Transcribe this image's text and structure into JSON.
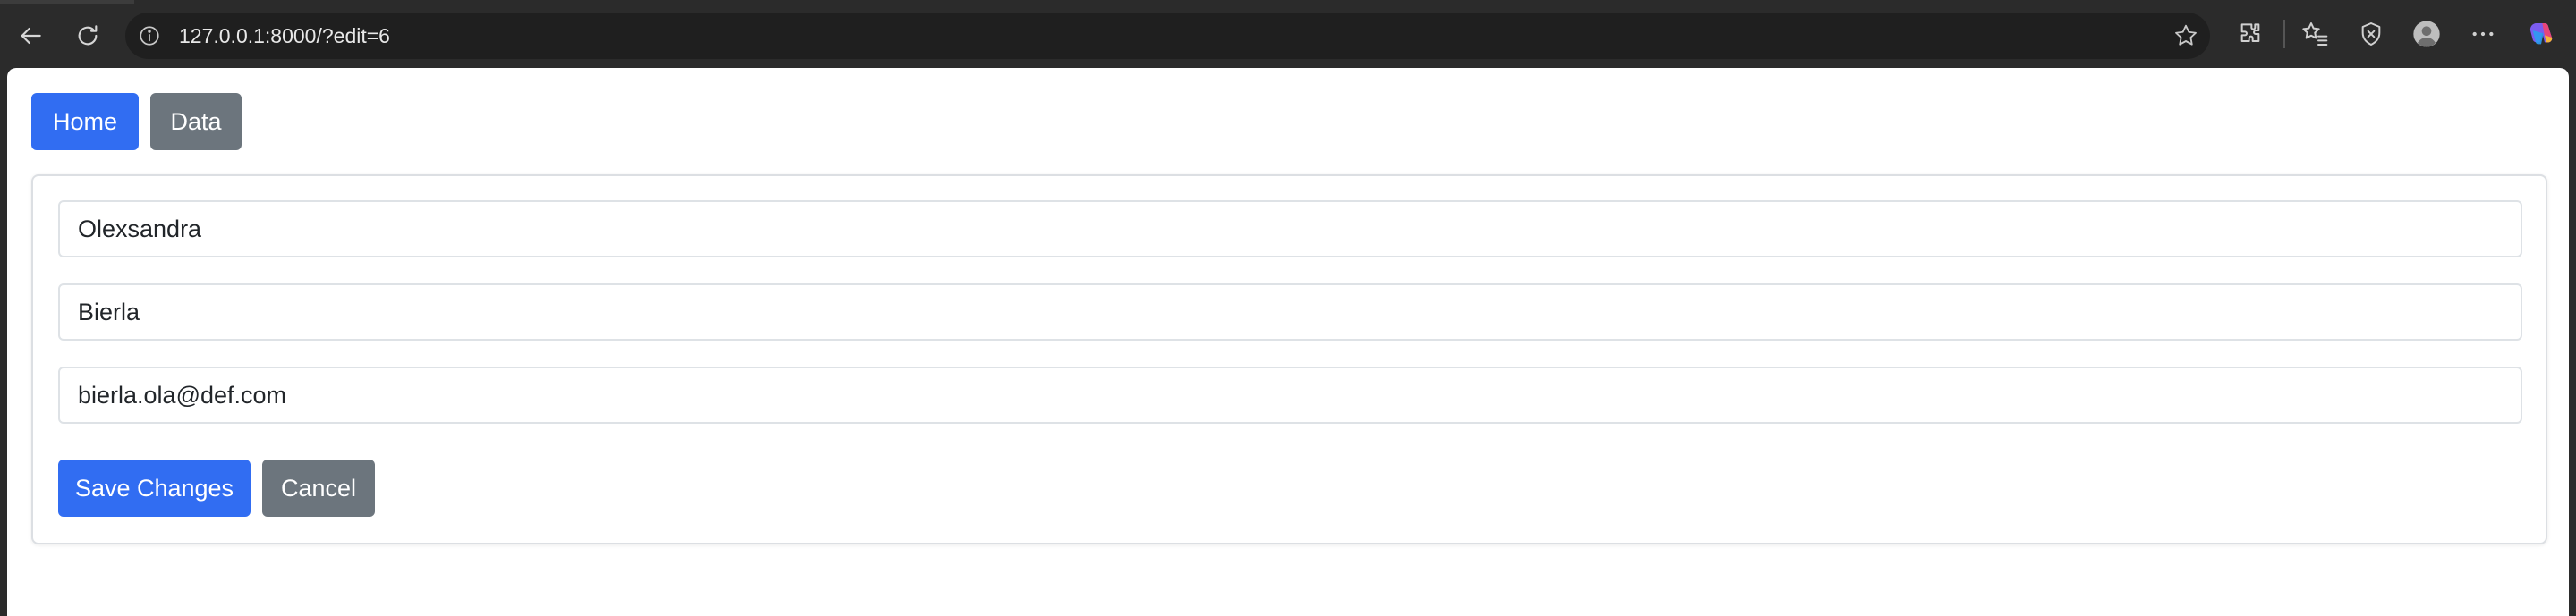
{
  "browser": {
    "url": "127.0.0.1:8000/?edit=6",
    "icons": [
      "back-arrow-icon",
      "reload-icon",
      "site-info-icon",
      "favorite-star-icon",
      "extensions-icon",
      "favorites-icon",
      "browser-essentials-icon",
      "profile-icon",
      "more-icon",
      "copilot-icon"
    ]
  },
  "nav": {
    "home_label": "Home",
    "data_label": "Data"
  },
  "form": {
    "first_name": "Olexsandra",
    "last_name": "Bierla",
    "email": "bierla.ola@def.com",
    "save_label": "Save Changes",
    "cancel_label": "Cancel"
  },
  "colors": {
    "primary": "#316df2",
    "secondary": "#6c757d",
    "chrome": "#2b2b2b"
  }
}
